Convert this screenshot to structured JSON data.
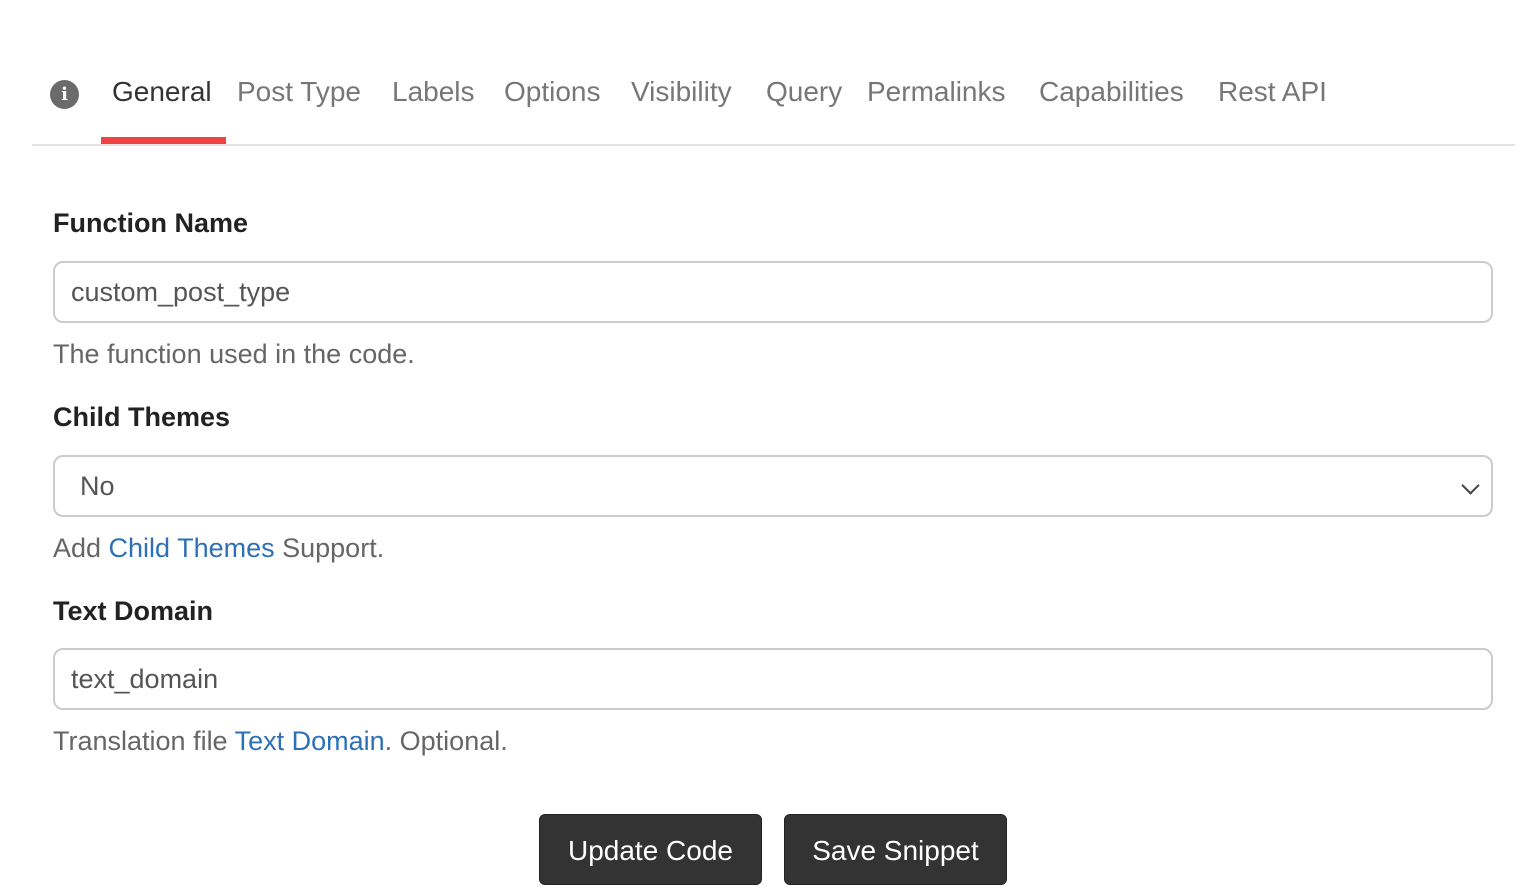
{
  "tabs": [
    {
      "label": "General",
      "active": true
    },
    {
      "label": "Post Type"
    },
    {
      "label": "Labels"
    },
    {
      "label": "Options"
    },
    {
      "label": "Visibility"
    },
    {
      "label": "Query"
    },
    {
      "label": "Permalinks"
    },
    {
      "label": "Capabilities"
    },
    {
      "label": "Rest API"
    }
  ],
  "accent_color": "#f04444",
  "link_color": "#2d70b7",
  "info_icon": "i",
  "fields": {
    "function_name": {
      "label": "Function Name",
      "value": "custom_post_type",
      "help": "The function used in the code."
    },
    "child_themes": {
      "label": "Child Themes",
      "value": "No",
      "help_prefix": "Add ",
      "help_link": "Child Themes",
      "help_suffix": " Support."
    },
    "text_domain": {
      "label": "Text Domain",
      "value": "text_domain",
      "help_prefix": "Translation file ",
      "help_link": "Text Domain",
      "help_suffix": ". Optional."
    }
  },
  "buttons": {
    "update": "Update Code",
    "save": "Save Snippet"
  }
}
